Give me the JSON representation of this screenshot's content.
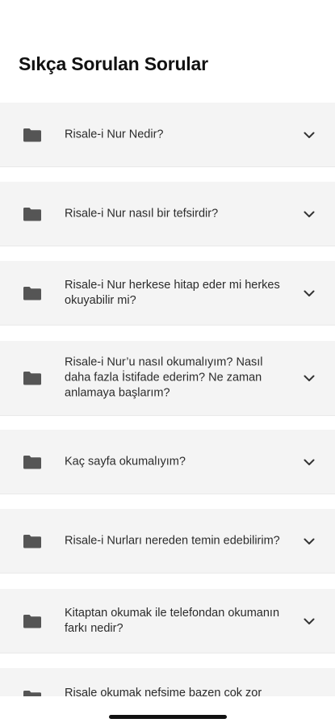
{
  "header": {
    "title": "Sıkça Sorulan Sorular"
  },
  "faq": {
    "items": [
      {
        "icon": "folder-icon",
        "question": "Risale-i Nur Nedir?",
        "chevron": "chevron-down-icon"
      },
      {
        "icon": "folder-icon",
        "question": "Risale-i Nur nasıl bir tefsirdir?",
        "chevron": "chevron-down-icon"
      },
      {
        "icon": "folder-icon",
        "question": "Risale-i Nur herkese hitap eder mi herkes okuyabilir mi?",
        "chevron": "chevron-down-icon"
      },
      {
        "icon": "folder-icon",
        "question": "Risale-i Nur’u nasıl okumalıyım? Nasıl daha fazla İstifade ederim? Ne zaman anlamaya başlarım?",
        "chevron": "chevron-down-icon"
      },
      {
        "icon": "folder-icon",
        "question": "Kaç sayfa okumalıyım?",
        "chevron": "chevron-down-icon"
      },
      {
        "icon": "folder-icon",
        "question": "Risale-i Nurları nereden temin edebilirim?",
        "chevron": "chevron-down-icon"
      },
      {
        "icon": "folder-icon",
        "question": "Kitaptan okumak ile telefondan okumanın farkı nedir?",
        "chevron": "chevron-down-icon"
      },
      {
        "icon": "folder-icon",
        "question": "Risale okumak nefsime bazen çok zor",
        "chevron": "chevron-down-icon"
      }
    ]
  },
  "colors": {
    "item_background": "#f4f4f4",
    "icon": "#555555",
    "text": "#2b2b2b"
  }
}
